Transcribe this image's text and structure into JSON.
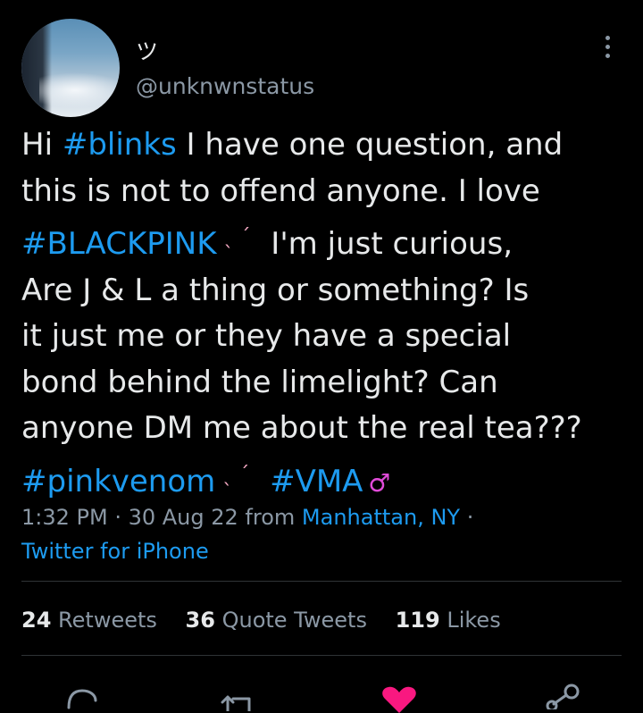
{
  "user": {
    "display_name": "ツ",
    "handle": "@unknwnstatus"
  },
  "tweet": {
    "lines": [
      [
        {
          "t": "Hi "
        },
        {
          "t": "#blinks",
          "tag": true
        },
        {
          "t": " I have one question, and"
        }
      ],
      [
        {
          "t": "this is not to offend anyone. I love"
        }
      ],
      [
        {
          "t": "#BLACKPINK",
          "tag": true
        },
        {
          "e": "ticks"
        },
        {
          "t": " I'm just curious,"
        }
      ],
      [
        {
          "t": "Are J & L a thing or something? Is"
        }
      ],
      [
        {
          "t": "it just me or they have a special"
        }
      ],
      [
        {
          "t": "bond behind the limelight? Can"
        }
      ],
      [
        {
          "t": "anyone DM me about the real tea???"
        }
      ],
      [
        {
          "t": "#pinkvenom",
          "tag": true
        },
        {
          "e": "ticks"
        },
        {
          "t": " "
        },
        {
          "t": "#VMA",
          "tag": true
        },
        {
          "e": "dancer"
        }
      ]
    ]
  },
  "meta": {
    "time": "1:32 PM",
    "separator": " · ",
    "date": "30 Aug 22",
    "from_label": " from ",
    "location": "Manhattan, NY",
    "trailing_sep": " ·",
    "source": "Twitter for iPhone"
  },
  "stats": {
    "retweets_count": "24",
    "retweets_label": "Retweets",
    "quotes_count": "36",
    "quotes_label": "Quote Tweets",
    "likes_count": "119",
    "likes_label": "Likes"
  },
  "icons": {
    "reply": "reply-icon",
    "retweet": "retweet-icon",
    "like": "heart-icon",
    "share": "share-icon",
    "more": "more-icon"
  },
  "colors": {
    "background": "#000000",
    "text": "#e7e9ea",
    "secondary": "#8b98a5",
    "link": "#1d9bf0",
    "like": "#f91880"
  }
}
